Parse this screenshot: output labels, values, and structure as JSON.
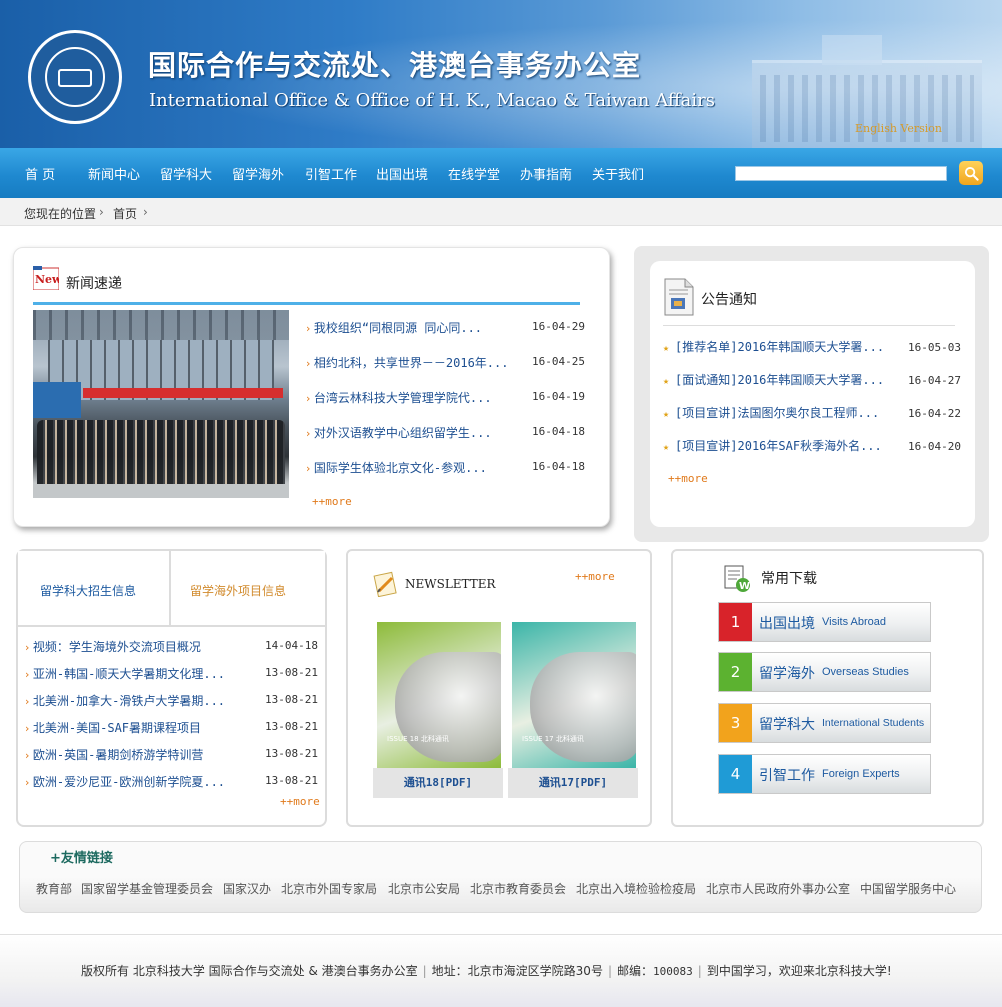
{
  "header": {
    "title_cn": "国际合作与交流处、港澳台事务办公室",
    "title_en": "International Office & Office of H. K., Macao & Taiwan Affairs",
    "english_version": "English Version"
  },
  "nav": {
    "items": [
      "首 页",
      "新闻中心",
      "留学科大",
      "留学海外",
      "引智工作",
      "出国出境",
      "在线学堂",
      "办事指南",
      "关于我们"
    ],
    "search_value": ""
  },
  "breadcrumb": {
    "prefix": "您现在的位置",
    "home": "首页"
  },
  "news": {
    "title": "新闻速递",
    "items": [
      {
        "text": "我校组织“同根同源 同心同...",
        "date": "16-04-29"
      },
      {
        "text": "相约北科，共享世界－－2016年...",
        "date": "16-04-25"
      },
      {
        "text": "台湾云林科技大学管理学院代...",
        "date": "16-04-19"
      },
      {
        "text": "对外汉语教学中心组织留学生...",
        "date": "16-04-18"
      },
      {
        "text": "国际学生体验北京文化-参观...",
        "date": "16-04-18"
      }
    ],
    "more": "++more"
  },
  "notice": {
    "title": "公告通知",
    "items": [
      {
        "text": "[推荐名单]2016年韩国顺天大学署...",
        "date": "16-05-03"
      },
      {
        "text": "[面试通知]2016年韩国顺天大学署...",
        "date": "16-04-27"
      },
      {
        "text": "[项目宣讲]法国图尔奥尔良工程师...",
        "date": "16-04-22"
      },
      {
        "text": "[项目宣讲]2016年SAF秋季海外名...",
        "date": "16-04-20"
      }
    ],
    "more": "++more"
  },
  "admission": {
    "tab_a": "留学科大招生信息",
    "tab_b": "留学海外项目信息",
    "items": [
      {
        "text": "视频：学生海境外交流项目概况",
        "date": "14-04-18"
      },
      {
        "text": "亚洲-韩国-顺天大学暑期文化理...",
        "date": "13-08-21"
      },
      {
        "text": "北美洲-加拿大-滑铁卢大学暑期...",
        "date": "13-08-21"
      },
      {
        "text": "北美洲-美国-SAF暑期课程项目",
        "date": "13-08-21"
      },
      {
        "text": "欧洲-英国-暑期剑桥游学特训营",
        "date": "13-08-21"
      },
      {
        "text": "欧洲-爱沙尼亚-欧洲创新学院夏...",
        "date": "13-08-21"
      }
    ],
    "more": "++more"
  },
  "newsletter": {
    "title": "NEWSLETTER",
    "more": "++more",
    "issues": [
      {
        "caption": "通讯18[PDF]",
        "cover_text": "ISSUE 18 北科通讯"
      },
      {
        "caption": "通讯17[PDF]",
        "cover_text": "ISSUE 17 北科通讯"
      }
    ],
    "colors": [
      "#8dbb3a",
      "#3bb5a8"
    ]
  },
  "downloads": {
    "title": "常用下载",
    "items": [
      {
        "num": "1",
        "cn": "出国出境",
        "en": "Visits Abroad",
        "color": "#d8232a"
      },
      {
        "num": "2",
        "cn": "留学海外",
        "en": "Overseas Studies",
        "color": "#5cb230"
      },
      {
        "num": "3",
        "cn": "留学科大",
        "en": "International Students",
        "color": "#f2a31c"
      },
      {
        "num": "4",
        "cn": "引智工作",
        "en": "Foreign Experts",
        "color": "#1f9bd6"
      }
    ]
  },
  "links": {
    "title": "+友情链接",
    "items": [
      "教育部",
      "国家留学基金管理委员会",
      "国家汉办",
      "北京市外国专家局",
      "北京市公安局",
      "北京市教育委员会",
      "北京出入境检验检疫局",
      "北京市人民政府外事办公室",
      "中国留学服务中心"
    ]
  },
  "footer": {
    "copyright": "版权所有 北京科技大学 国际合作与交流处 & 港澳台事务办公室",
    "address": "地址：北京市海淀区学院路30号",
    "postcode_label": "邮编：",
    "postcode": "100083",
    "welcome": "到中国学习，欢迎来北京科技大学!"
  }
}
